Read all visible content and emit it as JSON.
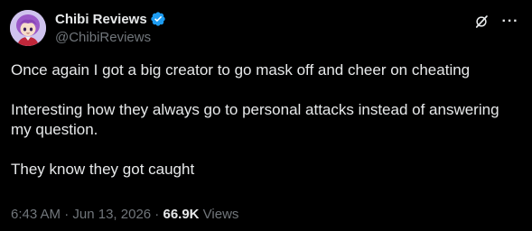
{
  "author": {
    "display_name": "Chibi Reviews",
    "handle": "@ChibiReviews",
    "verified": true
  },
  "actions": {
    "grok_icon": "grok-slash-icon",
    "more_icon": "more-dots-icon",
    "more_label": "···"
  },
  "tweet": {
    "paragraphs": [
      "Once again I got a big creator to go mask off and cheer on cheating",
      "Interesting how they always go to personal attacks instead of answering my question.",
      "They know they got caught"
    ]
  },
  "meta": {
    "time": "6:43 AM",
    "sep1": " · ",
    "date": "Jun 13, 2026",
    "sep2": " · ",
    "views_count": "66.9K",
    "views_label": " Views"
  },
  "colors": {
    "background": "#000000",
    "text_primary": "#e7e9ea",
    "text_secondary": "#71767b",
    "verified_blue": "#1d9bf0"
  }
}
